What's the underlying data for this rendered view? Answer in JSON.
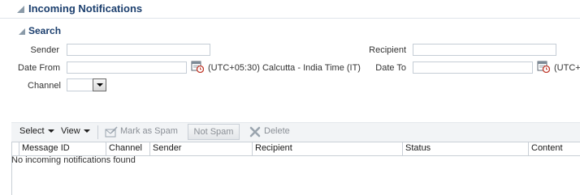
{
  "panel": {
    "title": "Incoming Notifications"
  },
  "search": {
    "title": "Search",
    "sender_label": "Sender",
    "sender_value": "",
    "recipient_label": "Recipient",
    "recipient_value": "",
    "date_from_label": "Date From",
    "date_from_value": "",
    "date_to_label": "Date To",
    "date_to_value": "",
    "timezone_from": "(UTC+05:30) Calcutta - India Time (IT)",
    "timezone_to": "(UTC+",
    "channel_label": "Channel",
    "channel_value": ""
  },
  "toolbar": {
    "select_label": "Select",
    "view_label": "View",
    "mark_spam_label": "Mark as Spam",
    "not_spam_label": "Not Spam",
    "delete_label": "Delete"
  },
  "table": {
    "columns": [
      "Message ID",
      "Channel",
      "Sender",
      "Recipient",
      "Status",
      "Content"
    ],
    "empty_text": "No incoming notifications found"
  },
  "colors": {
    "header_text": "#1c3f6e",
    "calendar_accent": "#c0392b",
    "delete_icon": "#9aa4ae"
  },
  "icons": [
    "collapse-triangle-icon",
    "calendar-icon",
    "dropdown-arrow-icon",
    "mark-spam-icon",
    "delete-icon"
  ]
}
